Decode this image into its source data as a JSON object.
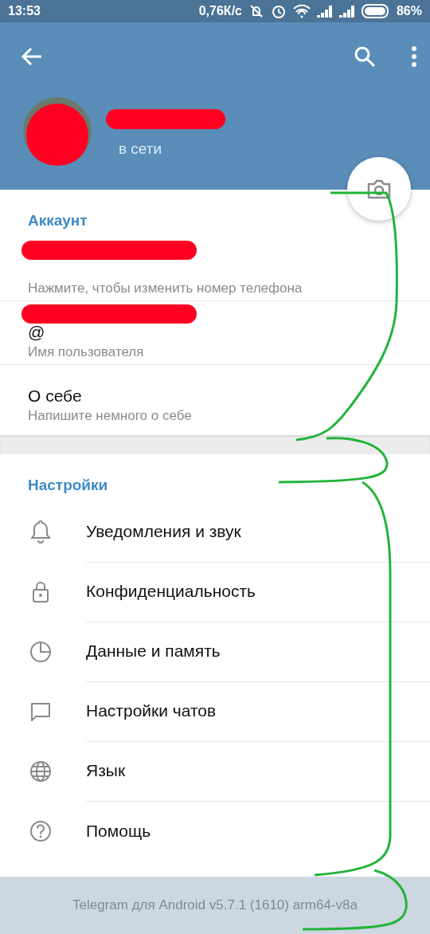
{
  "status_bar": {
    "time": "13:53",
    "speed": "0,76К/с",
    "battery": "86%"
  },
  "header": {
    "status": "в сети"
  },
  "account": {
    "title": "Аккаунт",
    "rows": [
      {
        "kind": "redacted",
        "subtitle": "Нажмите, чтобы изменить номер телефона"
      },
      {
        "kind": "redacted",
        "prefix": "@",
        "subtitle": "Имя пользователя"
      },
      {
        "kind": "text",
        "value": "О себе",
        "subtitle": "Напишите немного о себе"
      }
    ]
  },
  "settings": {
    "title": "Настройки",
    "items": [
      {
        "label": "Уведомления и звук"
      },
      {
        "label": "Конфиденциальность"
      },
      {
        "label": "Данные и память"
      },
      {
        "label": "Настройки чатов"
      },
      {
        "label": "Язык"
      },
      {
        "label": "Помощь"
      }
    ]
  },
  "footer": "Telegram для Android v5.7.1 (1610) arm64-v8a"
}
